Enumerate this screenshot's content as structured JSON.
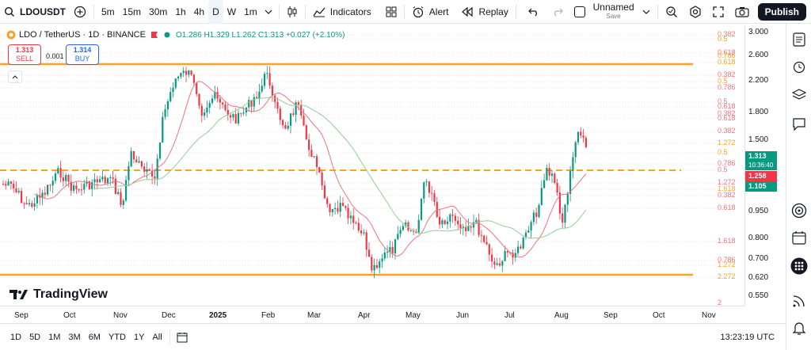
{
  "toolbar": {
    "symbol": "LDOUSDT",
    "intervals": [
      "5m",
      "15m",
      "30m",
      "1h",
      "4h",
      "D",
      "W",
      "1m"
    ],
    "active_interval": "D",
    "indicators_label": "Indicators",
    "alert_label": "Alert",
    "replay_label": "Replay",
    "layout_name": "Unnamed",
    "layout_status": "Save",
    "publish_label": "Publish"
  },
  "legend": {
    "title": "LDO / TetherUS · 1D · BINANCE",
    "ohlc": "O1.286 H1.329 L1.262 C1.313 +0.027 (+2.10%)"
  },
  "trade": {
    "sell_price": "1.313",
    "sell_label": "SELL",
    "spread": "0.001",
    "buy_price": "1.314",
    "buy_label": "BUY"
  },
  "price_axis": [
    "3.000",
    "2.600",
    "2.200",
    "1.800",
    "1.500",
    "1.313",
    "0.950",
    "0.800",
    "0.700",
    "0.620",
    "0.550"
  ],
  "price_badges": {
    "last": "1.313",
    "countdown": "10:36:40",
    "red": "1.258",
    "green": "1.105"
  },
  "fib_labels_right": [
    "0.382",
    "0.5",
    "0.618",
    "0.786",
    "0.618",
    "0.382",
    "0.5",
    "0.786",
    "0.5",
    "0.618",
    "0.382",
    "0.618",
    "0.382",
    "1.272",
    "0.5",
    "0.786",
    "0.5",
    "1.272",
    "1.618",
    "0.382",
    "0.618",
    "1.618",
    "0.786",
    "1.272",
    "2.272",
    "2"
  ],
  "time_axis": [
    "Sep",
    "Oct",
    "Nov",
    "Dec",
    "2025",
    "Feb",
    "Mar",
    "Apr",
    "May",
    "Jun",
    "Jul",
    "Aug",
    "Sep",
    "Oct",
    "Nov"
  ],
  "bottom": {
    "ranges": [
      "1D",
      "5D",
      "1M",
      "3M",
      "6M",
      "YTD",
      "1Y",
      "All"
    ],
    "clock": "13:23:19 UTC"
  },
  "brand": "TradingView",
  "colors": {
    "up": "#089981",
    "down": "#f23645",
    "horizontal_line": "#f7a325",
    "ma_red": "#f0747d",
    "ma_green": "#8fcf9a"
  }
}
